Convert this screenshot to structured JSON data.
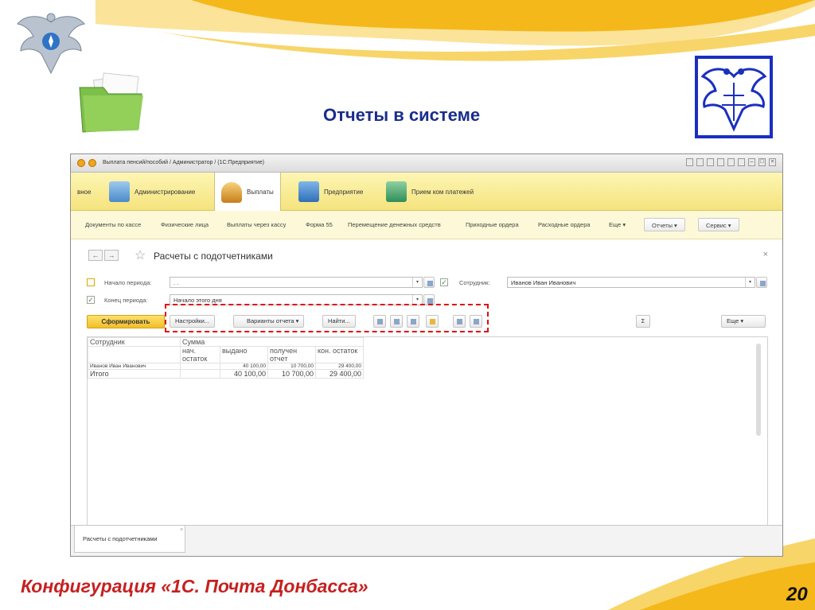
{
  "slide": {
    "title": "Отчеты в системе",
    "footer": "Конфигурация «1С. Почта Донбасса»",
    "page_number": "20",
    "colors": {
      "title": "#1a2d8c",
      "footer": "#c62020",
      "swoosh": "#f5b81b",
      "emblem_frame": "#1a2fbf"
    }
  },
  "window": {
    "title": "Выплата пенсий/пособий / Администратор / (1С:Предприятие)"
  },
  "sections": [
    {
      "label": "вное"
    },
    {
      "label": "Администрирование",
      "icon": "admin-icon"
    },
    {
      "label": "Выплаты",
      "icon": "payments-icon",
      "active": true
    },
    {
      "label": "Предприятие",
      "icon": "enterprise-icon"
    },
    {
      "label": "Прием ком платежей",
      "icon": "payments-receive-icon"
    }
  ],
  "commands": [
    "Документы по кассе",
    "Физические лица",
    "Выплаты через кассу",
    "Форма 55",
    "Перемещение денежных средств",
    "Приходные ордера",
    "Расходные ордера",
    "Еще ▾"
  ],
  "command_buttons": {
    "reports": "Отчеты ▾",
    "service": "Сервис ▾"
  },
  "form": {
    "title": "Расчеты с подотчетниками",
    "period_start": {
      "label": "Начало периода:",
      "value": ". .",
      "checked": false
    },
    "period_end": {
      "label": "Конец периода:",
      "value": "Начало этого дня",
      "checked": true
    },
    "employee": {
      "label": "Сотрудник:",
      "value": "Иванов Иван Иванович",
      "checked": true
    }
  },
  "toolbar": {
    "generate": "Сформировать",
    "settings": "Настройки...",
    "variants": "Варианты отчета",
    "find": "Найти...",
    "more": "Еще",
    "sum_symbol": "Σ"
  },
  "report": {
    "header1": [
      "Сотрудник",
      "Сумма"
    ],
    "header2": [
      "нач. остаток",
      "выдано",
      "получен отчет",
      "кон. остаток"
    ],
    "rows": [
      {
        "name": "Иванов Иван Иванович",
        "start": "",
        "issued": "40 100,00",
        "reported": "10 700,00",
        "end": "29 400,00"
      }
    ],
    "total": {
      "name": "Итого",
      "start": "",
      "issued": "40 100,00",
      "reported": "10 700,00",
      "end": "29 400,00"
    }
  },
  "taskbar": {
    "tab": "Расчеты с подотчетниками"
  }
}
